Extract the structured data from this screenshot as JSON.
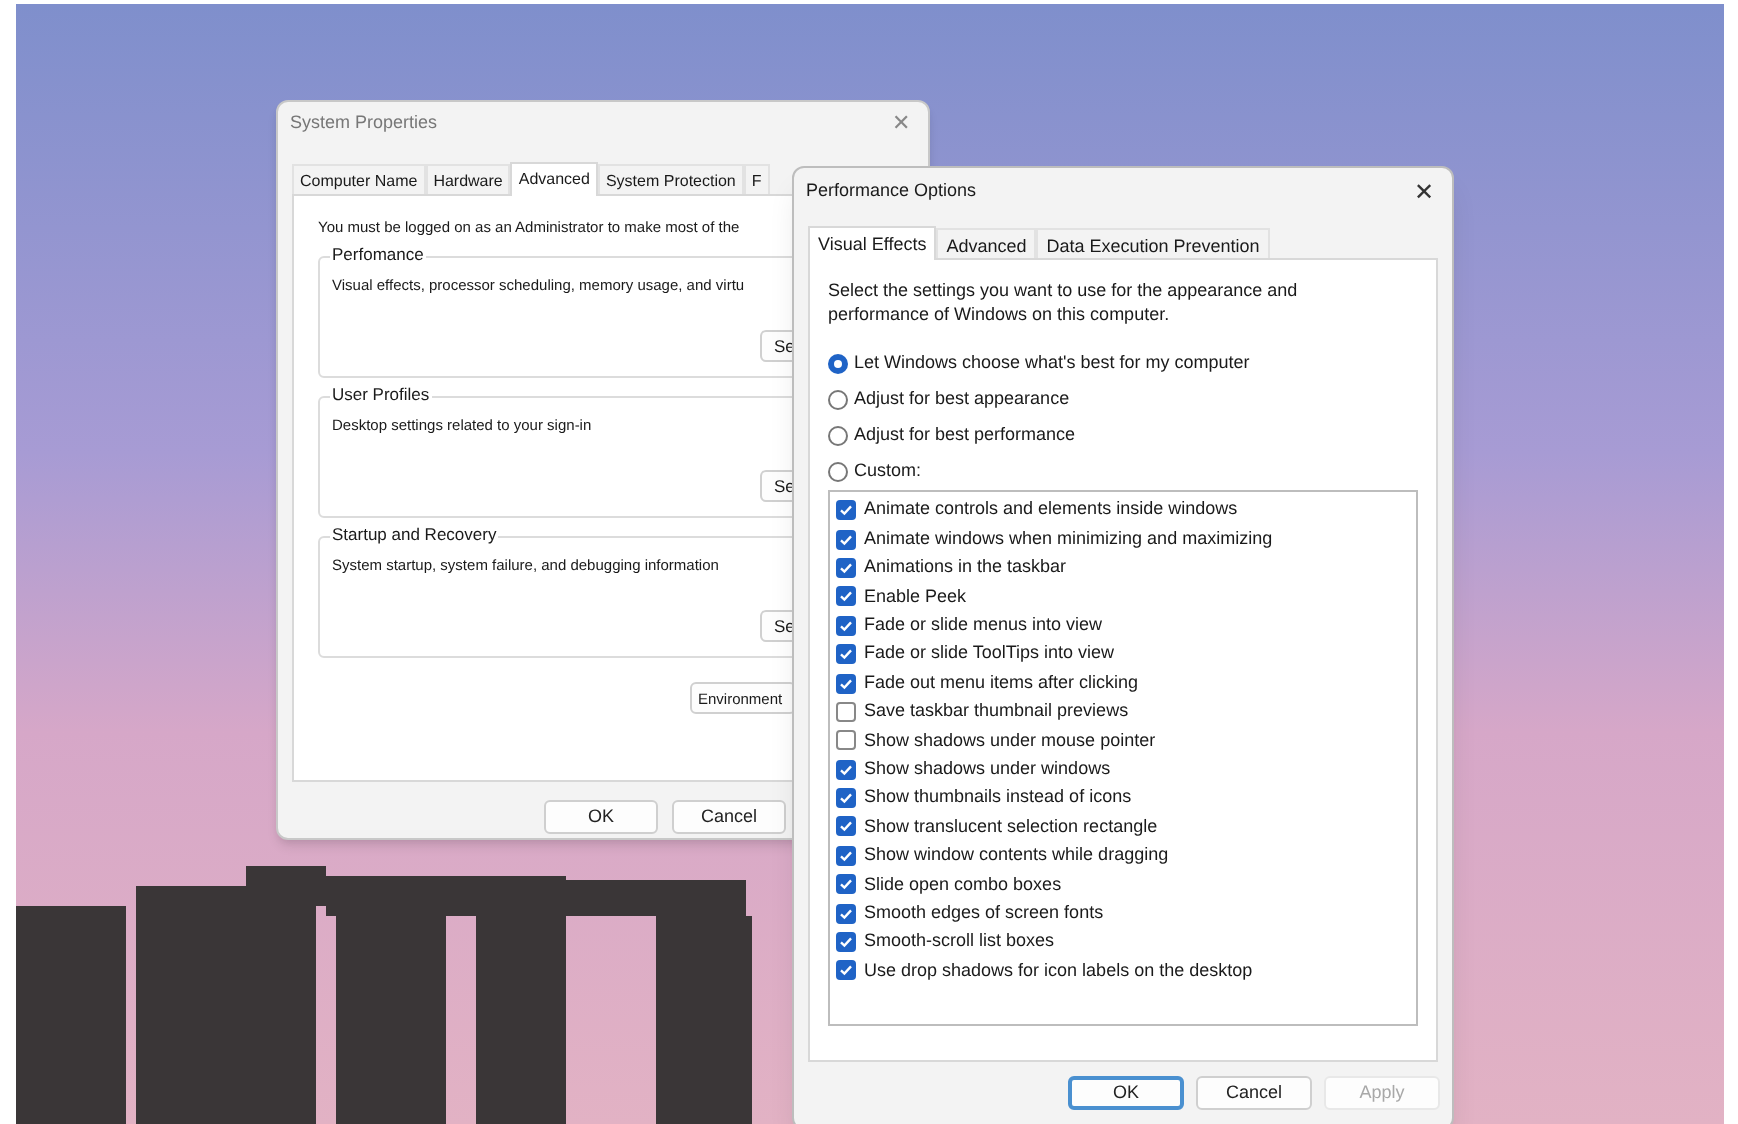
{
  "system_properties": {
    "title": "System Properties",
    "close": "✕",
    "tabs": [
      {
        "label": "Computer Name",
        "selected": false
      },
      {
        "label": "Hardware",
        "selected": false
      },
      {
        "label": "Advanced",
        "selected": true
      },
      {
        "label": "System Protection",
        "selected": false
      },
      {
        "label": "F",
        "selected": false
      }
    ],
    "notice": "You must be logged on as an Administrator to make most of the",
    "groups": [
      {
        "title": "Perfomance",
        "description": "Visual effects, processor scheduling, memory usage, and virtu",
        "button": "Se"
      },
      {
        "title": "User Profiles",
        "description": "Desktop settings related to your sign-in",
        "button": "Se"
      },
      {
        "title": "Startup and Recovery",
        "description": "System startup, system failure, and debugging information",
        "button": "Se"
      }
    ],
    "environment_button": "Environment",
    "buttons": [
      {
        "label": "OK",
        "disabled": false
      },
      {
        "label": "Cancel",
        "disabled": false
      }
    ]
  },
  "performance_options": {
    "title": "Performance Options",
    "close": "✕",
    "tabs": [
      {
        "label": "Visual Effects",
        "selected": true
      },
      {
        "label": "Advanced",
        "selected": false
      },
      {
        "label": "Data Execution Prevention",
        "selected": false
      }
    ],
    "intro": "Select the settings you want to use for the appearance and performance of Windows on this computer.",
    "radios": [
      {
        "label": "Let Windows choose what's best for my computer",
        "selected": true
      },
      {
        "label": "Adjust for best appearance",
        "selected": false
      },
      {
        "label": "Adjust for best performance",
        "selected": false
      },
      {
        "label": "Custom:",
        "selected": false
      }
    ],
    "effects": [
      {
        "label": "Animate controls and elements inside windows",
        "checked": true
      },
      {
        "label": "Animate windows when minimizing and maximizing",
        "checked": true
      },
      {
        "label": "Animations in the taskbar",
        "checked": true
      },
      {
        "label": "Enable Peek",
        "checked": true
      },
      {
        "label": "Fade or slide menus into view",
        "checked": true
      },
      {
        "label": "Fade or slide ToolTips into view",
        "checked": true
      },
      {
        "label": "Fade out menu items after clicking",
        "checked": true
      },
      {
        "label": "Save taskbar thumbnail previews",
        "checked": false
      },
      {
        "label": "Show shadows under mouse pointer",
        "checked": false
      },
      {
        "label": "Show shadows under windows",
        "checked": true
      },
      {
        "label": "Show thumbnails instead of icons",
        "checked": true
      },
      {
        "label": "Show translucent selection rectangle",
        "checked": true
      },
      {
        "label": "Show window contents while dragging",
        "checked": true
      },
      {
        "label": "Slide open combo boxes",
        "checked": true
      },
      {
        "label": "Smooth edges of screen fonts",
        "checked": true
      },
      {
        "label": "Smooth-scroll list boxes",
        "checked": true
      },
      {
        "label": "Use drop shadows for icon labels on the desktop",
        "checked": true
      }
    ],
    "buttons": [
      {
        "label": "OK",
        "disabled": false,
        "default": true
      },
      {
        "label": "Cancel",
        "disabled": false,
        "default": false
      },
      {
        "label": "Apply",
        "disabled": true,
        "default": false
      }
    ]
  }
}
